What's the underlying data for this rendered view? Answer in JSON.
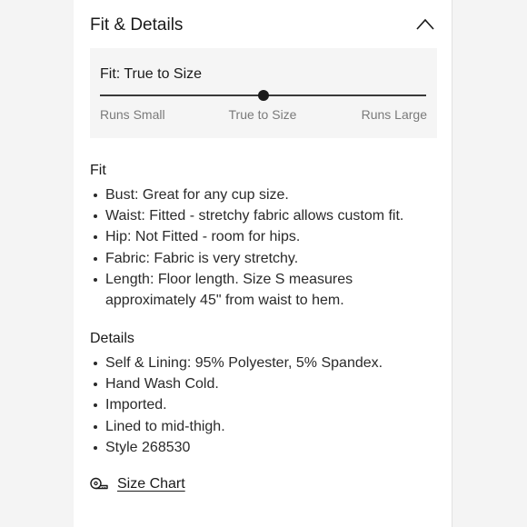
{
  "header": {
    "title": "Fit & Details"
  },
  "fit_scale": {
    "title": "Fit: True to Size",
    "position": 0.5,
    "labels": {
      "small": "Runs Small",
      "true": "True to Size",
      "large": "Runs Large"
    }
  },
  "fit": {
    "heading": "Fit",
    "items": [
      "Bust: Great for any cup size.",
      "Waist: Fitted - stretchy fabric allows custom fit.",
      "Hip: Not Fitted - room for hips.",
      "Fabric: Fabric is very stretchy.",
      "Length: Floor length. Size S measures approximately 45\" from waist to hem."
    ]
  },
  "details": {
    "heading": "Details",
    "items": [
      "Self & Lining: 95% Polyester, 5% Spandex.",
      "Hand Wash Cold.",
      "Imported.",
      "Lined to mid-thigh.",
      "Style 268530"
    ]
  },
  "size_chart": {
    "label": "Size Chart",
    "icon": "tape-measure-icon"
  },
  "icons": {
    "collapse": "chevron-up-icon"
  },
  "colors": {
    "text": "#1a1a1a",
    "muted": "#7a7a7a",
    "panel": "#ffffff",
    "page_bg": "#f4f4f4",
    "fit_box": "#f5f5f5"
  }
}
